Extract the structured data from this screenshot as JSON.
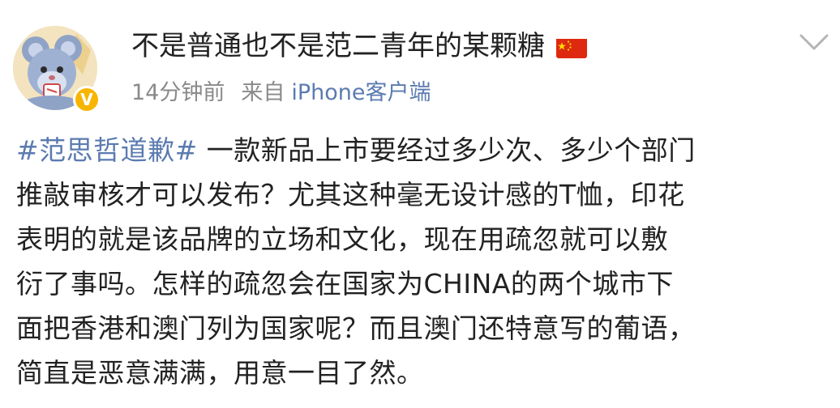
{
  "post": {
    "username": "不是普通也不是范二青年的某颗糖",
    "flag_icon": "china-flag-icon",
    "time": "14分钟前",
    "from_label": "来自",
    "device": "iPhone客户端",
    "topic": "#范思哲道歉#",
    "body_lines": [
      " 一款新品上市要经过多少次、多少个部门",
      "推敲审核才可以发布？尤其这种毫无设计感的T恤，印花",
      "表明的就是该品牌的立场和文化，现在用疏忽就可以敷",
      "衍了事吗。怎样的疏忽会在国家为CHINA的两个城市下",
      "面把香港和澳门列为国家呢？而且澳门还特意写的葡语，",
      "简直是恶意满满，用意一目了然。"
    ],
    "verified_mark": "V"
  },
  "colors": {
    "link": "#5b7bb0",
    "meta": "#8a8a8a",
    "text": "#222222",
    "badge": "#f7b500"
  }
}
